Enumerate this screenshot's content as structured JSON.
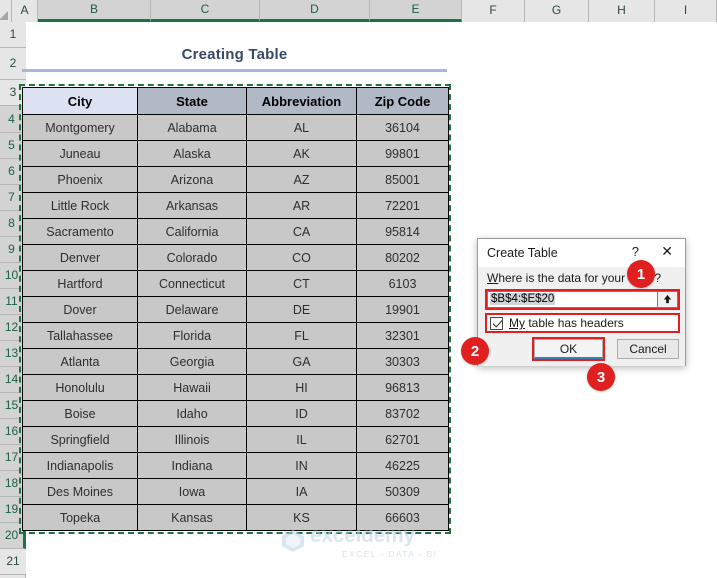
{
  "spreadsheet": {
    "columns": [
      "A",
      "B",
      "C",
      "D",
      "E",
      "F",
      "G",
      "H",
      "I"
    ],
    "selected_columns": [
      "B",
      "C",
      "D",
      "E"
    ],
    "rows": [
      "1",
      "2",
      "3",
      "4",
      "5",
      "6",
      "7",
      "8",
      "9",
      "10",
      "11",
      "12",
      "13",
      "14",
      "15",
      "16",
      "17",
      "18",
      "19",
      "20",
      "21"
    ],
    "selected_rows": [
      "4",
      "5",
      "6",
      "7",
      "8",
      "9",
      "10",
      "11",
      "12",
      "13",
      "14",
      "15",
      "16",
      "17",
      "18",
      "19",
      "20"
    ],
    "title": "Creating Table",
    "selection_range": "B4:E20"
  },
  "table": {
    "headers": [
      "City",
      "State",
      "Abbreviation",
      "Zip Code"
    ],
    "active_header": "City",
    "rows": [
      [
        "Montgomery",
        "Alabama",
        "AL",
        "36104"
      ],
      [
        "Juneau",
        "Alaska",
        "AK",
        "99801"
      ],
      [
        "Phoenix",
        "Arizona",
        "AZ",
        "85001"
      ],
      [
        "Little Rock",
        "Arkansas",
        "AR",
        "72201"
      ],
      [
        "Sacramento",
        "California",
        "CA",
        "95814"
      ],
      [
        "Denver",
        "Colorado",
        "CO",
        "80202"
      ],
      [
        "Hartford",
        "Connecticut",
        "CT",
        "6103"
      ],
      [
        "Dover",
        "Delaware",
        "DE",
        "19901"
      ],
      [
        "Tallahassee",
        "Florida",
        "FL",
        "32301"
      ],
      [
        "Atlanta",
        "Georgia",
        "GA",
        "30303"
      ],
      [
        "Honolulu",
        "Hawaii",
        "HI",
        "96813"
      ],
      [
        "Boise",
        "Idaho",
        "ID",
        "83702"
      ],
      [
        "Springfield",
        "Illinois",
        "IL",
        "62701"
      ],
      [
        "Indianapolis",
        "Indiana",
        "IN",
        "46225"
      ],
      [
        "Des Moines",
        "Iowa",
        "IA",
        "50309"
      ],
      [
        "Topeka",
        "Kansas",
        "KS",
        "66603"
      ]
    ]
  },
  "dialog": {
    "title": "Create Table",
    "help_icon": "?",
    "close_icon": "✕",
    "prompt_prefix": "W",
    "prompt_rest": "here is the data for your table?",
    "range_value": "$B$4:$E$20",
    "collapse_icon": "↑",
    "checkbox_label_prefix": "My",
    "checkbox_label_rest": " table has headers",
    "checkbox_checked": "true",
    "ok_label": "OK",
    "cancel_label": "Cancel"
  },
  "callouts": {
    "one": "1",
    "two": "2",
    "three": "3"
  },
  "watermark": {
    "name": "exceldemy",
    "tagline": "EXCEL - DATA - BI"
  },
  "colors": {
    "selection_green": "#1f7244",
    "callout_red": "#e02020",
    "header_fill": "#b1b8c6",
    "active_header_fill": "#dde2f2",
    "data_fill": "#c8c8c8",
    "title_text": "#39496b",
    "title_rule": "#a3b8dc"
  }
}
